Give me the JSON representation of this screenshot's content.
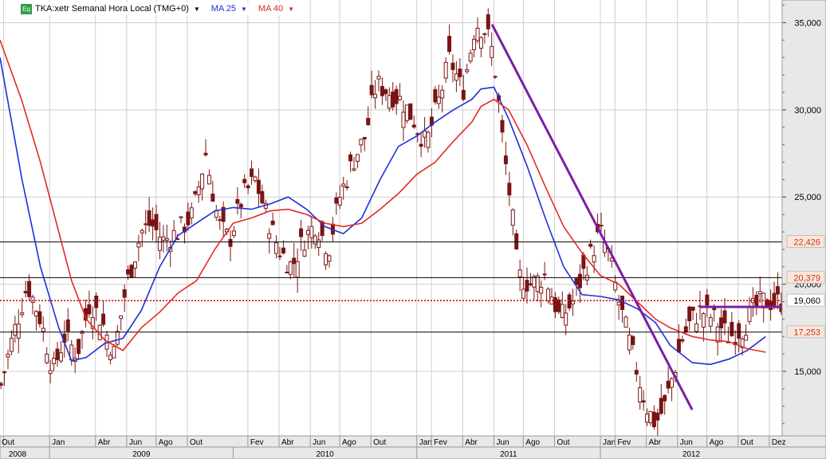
{
  "legend": {
    "badge": "Eq",
    "symbol": "TKA:xetr Semanal Hora Local (TMG+0)",
    "ma_fast": "MA 25",
    "ma_slow": "MA 40",
    "colors": {
      "symbol": "#000000",
      "ma_fast": "#1f2fd8",
      "ma_slow": "#e02020",
      "arrow": "#000000"
    }
  },
  "colors": {
    "ma25": "#1f2fd8",
    "ma40": "#e52a22",
    "candles": "#7a1414",
    "trendline": "#7b1fa2",
    "hline": "#000000",
    "dotted": "#d00000",
    "grid": "#cfcfcf",
    "plot_bg": "#ffffff",
    "axis_bg": "#e8e8e8",
    "tag_bg": "#fbe6d8",
    "tag_red_text": "#c0392b"
  },
  "chart_data": {
    "type": "candlestick",
    "title": "TKA:xetr Semanal Hora Local (TMG+0)",
    "y_axis": {
      "ticks": [
        "35,000",
        "30,000",
        "25,000",
        "20,000",
        "15,000"
      ],
      "tick_values": [
        35,
        30,
        25,
        20,
        15
      ],
      "range": [
        11.3,
        36.3
      ]
    },
    "x_axis": {
      "months": [
        "Out",
        "Jan",
        "Abr",
        "Jun",
        "Ago",
        "Out",
        "Fev",
        "Abr",
        "Jun",
        "Ago",
        "Out",
        "Jan",
        "Fev",
        "Abr",
        "Jun",
        "Ago",
        "Out",
        "Jan",
        "Fev",
        "Abr",
        "Jun",
        "Ago",
        "Out",
        "Dez"
      ],
      "month_dates": [
        2008.75,
        2009.0,
        2009.25,
        2009.42,
        2009.58,
        2009.75,
        2010.08,
        2010.25,
        2010.42,
        2010.58,
        2010.75,
        2011.0,
        2011.08,
        2011.25,
        2011.42,
        2011.58,
        2011.75,
        2012.0,
        2012.08,
        2012.25,
        2012.42,
        2012.58,
        2012.75,
        2012.92
      ],
      "years": [
        "2008",
        "2009",
        "2010",
        "2011",
        "2012"
      ],
      "year_dates": [
        2008.63,
        2009.0,
        2010.0,
        2011.0,
        2012.0
      ],
      "range": [
        2008.73,
        2012.99
      ]
    },
    "series": [
      {
        "name": "MA 25",
        "x": [
          2008.73,
          2008.85,
          2008.95,
          2009.05,
          2009.12,
          2009.2,
          2009.3,
          2009.4,
          2009.5,
          2009.6,
          2009.7,
          2009.8,
          2009.9,
          2010.0,
          2010.1,
          2010.2,
          2010.3,
          2010.4,
          2010.5,
          2010.6,
          2010.7,
          2010.8,
          2010.9,
          2011.0,
          2011.1,
          2011.2,
          2011.3,
          2011.35,
          2011.42,
          2011.5,
          2011.6,
          2011.7,
          2011.8,
          2011.9,
          2012.0,
          2012.1,
          2012.2,
          2012.3,
          2012.38,
          2012.5,
          2012.6,
          2012.7,
          2012.8,
          2012.9
        ],
        "values": [
          33.0,
          26.0,
          21.0,
          17.5,
          15.6,
          15.8,
          16.6,
          16.9,
          18.5,
          21.0,
          22.8,
          23.5,
          24.2,
          24.4,
          24.3,
          24.6,
          25.0,
          24.3,
          23.3,
          22.9,
          23.8,
          26.0,
          27.9,
          28.5,
          29.3,
          30.0,
          30.6,
          31.2,
          31.3,
          29.5,
          26.8,
          23.8,
          21.0,
          19.4,
          19.3,
          19.1,
          18.6,
          17.8,
          16.5,
          15.5,
          15.4,
          15.7,
          16.2,
          17.0
        ]
      },
      {
        "name": "MA 40",
        "x": [
          2008.73,
          2008.85,
          2008.95,
          2009.05,
          2009.12,
          2009.2,
          2009.3,
          2009.4,
          2009.5,
          2009.6,
          2009.7,
          2009.8,
          2009.9,
          2010.0,
          2010.1,
          2010.2,
          2010.3,
          2010.4,
          2010.5,
          2010.6,
          2010.7,
          2010.8,
          2010.9,
          2011.0,
          2011.1,
          2011.2,
          2011.3,
          2011.35,
          2011.42,
          2011.5,
          2011.6,
          2011.7,
          2011.8,
          2011.9,
          2012.0,
          2012.1,
          2012.2,
          2012.3,
          2012.38,
          2012.5,
          2012.6,
          2012.7,
          2012.8,
          2012.9
        ],
        "values": [
          34.0,
          30.5,
          27.0,
          23.0,
          20.2,
          18.0,
          16.8,
          16.2,
          17.5,
          18.4,
          19.5,
          20.2,
          22.0,
          23.5,
          23.8,
          24.2,
          24.3,
          24.0,
          23.5,
          23.3,
          23.5,
          24.3,
          25.2,
          26.3,
          27.0,
          28.2,
          29.3,
          30.2,
          30.6,
          30.0,
          28.0,
          25.6,
          23.3,
          21.8,
          20.5,
          20.0,
          19.0,
          18.0,
          17.5,
          17.0,
          16.8,
          16.7,
          16.3,
          16.1
        ]
      }
    ],
    "trendlines": [
      {
        "x": [
          2011.41,
          2012.5
        ],
        "values": [
          34.9,
          12.8
        ]
      },
      {
        "x": [
          2012.54,
          2012.985
        ],
        "values": [
          18.7,
          18.7
        ]
      }
    ],
    "horizontal_lines": [
      {
        "value": 22.426,
        "label": "22,426",
        "style": "solid"
      },
      {
        "value": 20.379,
        "label": "20,379",
        "style": "solid"
      },
      {
        "value": 17.253,
        "label": "17,253",
        "style": "solid"
      },
      {
        "value": 19.06,
        "label": "19,060",
        "style": "dotted"
      }
    ],
    "candle_anchors": {
      "x": [
        2008.73,
        2008.8,
        2008.88,
        2008.95,
        2009.02,
        2009.08,
        2009.15,
        2009.22,
        2009.28,
        2009.35,
        2009.42,
        2009.5,
        2009.55,
        2009.62,
        2009.7,
        2009.78,
        2009.85,
        2009.92,
        2009.98,
        2010.05,
        2010.12,
        2010.18,
        2010.25,
        2010.32,
        2010.38,
        2010.45,
        2010.52,
        2010.58,
        2010.65,
        2010.72,
        2010.78,
        2010.85,
        2010.92,
        2010.98,
        2011.05,
        2011.12,
        2011.18,
        2011.25,
        2011.32,
        2011.38,
        2011.42,
        2011.47,
        2011.52,
        2011.55,
        2011.62,
        2011.7,
        2011.78,
        2011.85,
        2011.92,
        2012.0,
        2012.05,
        2012.1,
        2012.15,
        2012.2,
        2012.25,
        2012.3,
        2012.35,
        2012.4,
        2012.45,
        2012.5,
        2012.55,
        2012.62,
        2012.7,
        2012.78,
        2012.83,
        2012.88,
        2012.94,
        2012.99
      ],
      "values": [
        14.0,
        17.0,
        20.0,
        18.0,
        15.0,
        17.0,
        16.0,
        19.0,
        18.0,
        16.0,
        20.0,
        23.0,
        23.5,
        22.5,
        23.0,
        24.0,
        27.5,
        23.5,
        22.5,
        25.0,
        26.0,
        24.0,
        22.0,
        21.0,
        22.5,
        23.5,
        22.0,
        25.0,
        27.0,
        28.5,
        31.5,
        31.0,
        30.5,
        29.5,
        28.0,
        30.5,
        33.0,
        31.0,
        35.0,
        34.5,
        33.0,
        28.0,
        24.0,
        20.5,
        20.0,
        20.5,
        18.0,
        19.0,
        21.0,
        23.0,
        21.5,
        19.0,
        17.0,
        15.0,
        13.0,
        12.0,
        13.0,
        15.0,
        17.0,
        18.0,
        18.5,
        18.0,
        17.0,
        17.5,
        18.5,
        19.0,
        19.0,
        19.0
      ]
    }
  }
}
